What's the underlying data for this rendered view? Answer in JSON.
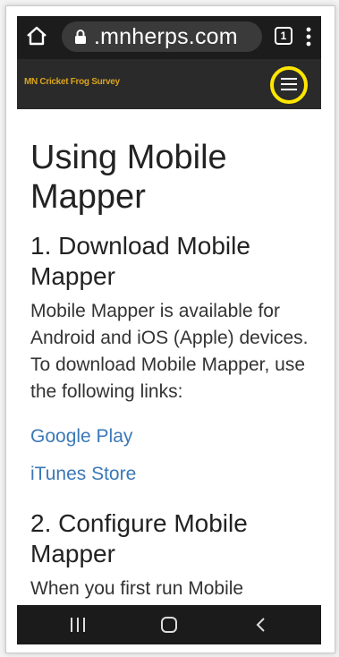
{
  "browser": {
    "url": ".mnherps.com",
    "tab_count": "1"
  },
  "site": {
    "title": "MN Cricket Frog Survey"
  },
  "page": {
    "title": "Using Mobile Mapper",
    "section1_heading": "1. Download Mobile Mapper",
    "section1_body": "Mobile Mapper is available for Android and iOS (Apple) devices. To download Mobile Mapper, use the following links:",
    "links": [
      "Google Play",
      "iTunes Store"
    ],
    "section2_heading": "2. Configure Mobile Mapper",
    "section2_body": "When you first run Mobile"
  },
  "colors": {
    "link": "#3b79b6",
    "site_title": "#d9a31f",
    "highlight_circle": "#ffe600"
  }
}
